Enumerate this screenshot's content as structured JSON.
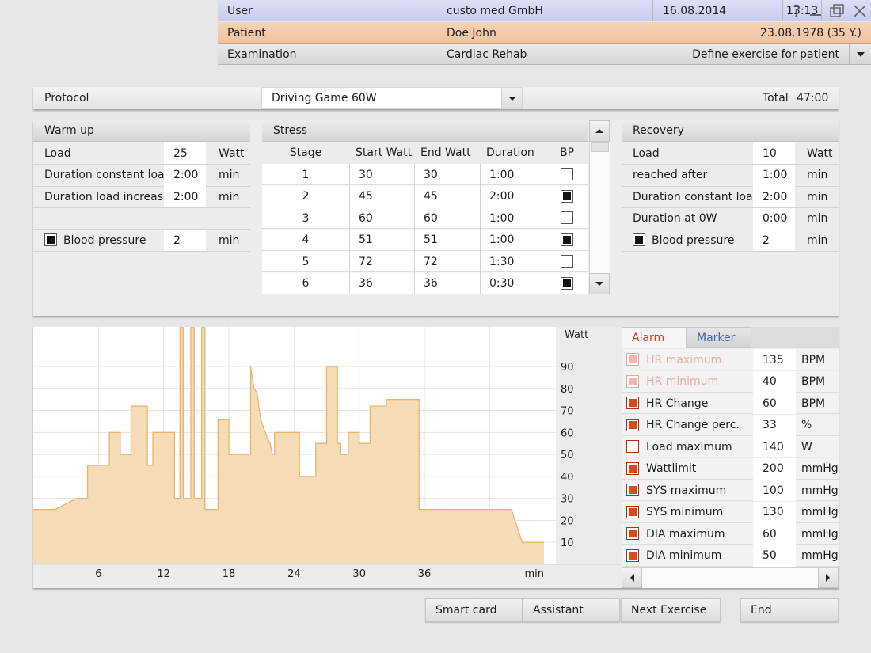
{
  "header": {
    "user_label": "User",
    "user_value": "custo med GmbH",
    "date": "16.08.2014",
    "time": "13:13",
    "patient_label": "Patient",
    "patient_name": "Doe John",
    "patient_birth": "23.08.1978 (35 Y.)",
    "exam_label": "Examination",
    "exam_value": "Cardiac Rehab",
    "exam_action": "Define exercise for patient",
    "icons": [
      "help-icon",
      "minimize-icon",
      "restore-icon",
      "close-icon",
      "dropdown-arrow-icon"
    ]
  },
  "protocol": {
    "label": "Protocol",
    "value": "Driving Game 60W",
    "total_label": "Total",
    "total_value": "47:00"
  },
  "warmup": {
    "title": "Warm up",
    "rows": [
      {
        "label": "Load",
        "value": "25",
        "unit": "Watt"
      },
      {
        "label": "Duration constant load",
        "value": "2:00",
        "unit": "min"
      },
      {
        "label": "Duration load increase",
        "value": "2:00",
        "unit": "min"
      }
    ],
    "bp": {
      "label": "Blood pressure",
      "value": "2",
      "unit": "min",
      "checked": true
    }
  },
  "stress": {
    "title": "Stress",
    "columns": [
      "Stage",
      "Start Watt",
      "End Watt",
      "Duration",
      "BP"
    ],
    "rows": [
      {
        "stage": "1",
        "start": "30",
        "end": "30",
        "duration": "1:00",
        "bp": false
      },
      {
        "stage": "2",
        "start": "45",
        "end": "45",
        "duration": "2:00",
        "bp": true
      },
      {
        "stage": "3",
        "start": "60",
        "end": "60",
        "duration": "1:00",
        "bp": false
      },
      {
        "stage": "4",
        "start": "51",
        "end": "51",
        "duration": "1:00",
        "bp": true
      },
      {
        "stage": "5",
        "start": "72",
        "end": "72",
        "duration": "1:30",
        "bp": false
      },
      {
        "stage": "6",
        "start": "36",
        "end": "36",
        "duration": "0:30",
        "bp": true
      }
    ]
  },
  "recovery": {
    "title": "Recovery",
    "rows": [
      {
        "label": "Load",
        "value": "10",
        "unit": "Watt"
      },
      {
        "label": "reached after",
        "value": "1:00",
        "unit": "min"
      },
      {
        "label": "Duration constant load",
        "value": "2:00",
        "unit": "min"
      },
      {
        "label": "Duration at 0W",
        "value": "0:00",
        "unit": "min"
      }
    ],
    "bp": {
      "label": "Blood pressure",
      "value": "2",
      "unit": "min",
      "checked": true
    }
  },
  "chart_data": {
    "type": "area",
    "ylabel": "Watt",
    "xlabel": "min",
    "xlim": [
      0,
      47
    ],
    "ylim": [
      0,
      108
    ],
    "x_ticks": [
      6,
      12,
      18,
      24,
      30,
      36
    ],
    "y_ticks": [
      10,
      20,
      30,
      40,
      50,
      60,
      70,
      80,
      90
    ],
    "fill_color": "#f6dcb6",
    "line_color": "#e7b46d",
    "series": [
      {
        "x": [
          0,
          2,
          4,
          5,
          5,
          7,
          7,
          8,
          8,
          9,
          9,
          10.5,
          10.5,
          11,
          11,
          13,
          13,
          13.5,
          13.5,
          13.8,
          13.8,
          14.5,
          14.5,
          14.8,
          14.8,
          15.5,
          15.5,
          15.8,
          15.8,
          17,
          17,
          18,
          18,
          20,
          20,
          20.3,
          20.6,
          20.8,
          21,
          21.2,
          21.5,
          21.8,
          22,
          22.2,
          22.2,
          24.5,
          24.5,
          26,
          26,
          27,
          27,
          28,
          28,
          28.3,
          28.3,
          29,
          29,
          30,
          30,
          31,
          31,
          32.5,
          32.5,
          35.5,
          35.5,
          44,
          44,
          45,
          47
        ],
        "y": [
          25,
          25,
          30,
          30,
          45,
          45,
          60,
          60,
          50,
          50,
          72,
          72,
          45,
          45,
          60,
          60,
          30,
          30,
          108,
          108,
          30,
          30,
          108,
          108,
          30,
          30,
          108,
          108,
          25,
          25,
          66,
          66,
          50,
          50,
          90,
          80,
          78,
          70,
          65,
          62,
          58,
          55,
          50,
          50,
          60,
          60,
          40,
          40,
          55,
          55,
          90,
          90,
          55,
          55,
          50,
          50,
          60,
          60,
          55,
          55,
          72,
          72,
          75,
          75,
          25,
          25,
          25,
          10,
          10
        ]
      }
    ]
  },
  "alarm": {
    "tab_alarm": "Alarm",
    "tab_marker": "Marker",
    "rows": [
      {
        "label": "HR maximum",
        "value": "135",
        "unit": "BPM",
        "checked": true,
        "dim": true
      },
      {
        "label": "HR minimum",
        "value": "40",
        "unit": "BPM",
        "checked": true,
        "dim": true
      },
      {
        "label": "HR Change",
        "value": "60",
        "unit": "BPM",
        "checked": true,
        "dim": false
      },
      {
        "label": "HR Change perc.",
        "value": "33",
        "unit": "%",
        "checked": true,
        "dim": false
      },
      {
        "label": "Load maximum",
        "value": "140",
        "unit": "W",
        "checked": false,
        "dim": false
      },
      {
        "label": "Wattlimit",
        "value": "200",
        "unit": "mmHg",
        "checked": true,
        "dim": false
      },
      {
        "label": "SYS maximum",
        "value": "100",
        "unit": "mmHg",
        "checked": true,
        "dim": false
      },
      {
        "label": "SYS minimum",
        "value": "130",
        "unit": "mmHg",
        "checked": true,
        "dim": false
      },
      {
        "label": "DIA maximum",
        "value": "60",
        "unit": "mmHg",
        "checked": true,
        "dim": false
      },
      {
        "label": "DIA minimum",
        "value": "50",
        "unit": "mmHg",
        "checked": true,
        "dim": false
      }
    ]
  },
  "footer": {
    "smart_card": "Smart card",
    "assistant": "Assistant",
    "next_exercise": "Next Exercise",
    "end": "End"
  }
}
